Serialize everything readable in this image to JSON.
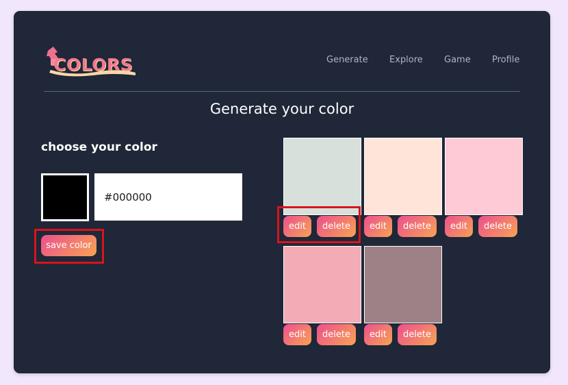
{
  "app": {
    "logo_text": "COLORS",
    "logo_icon": "paint-bucket-icon"
  },
  "nav": [
    "Generate",
    "Explore",
    "Game",
    "Profile"
  ],
  "page_title": "Generate your color",
  "picker": {
    "heading": "choose your color",
    "selected_color": "#000000",
    "hex_value": "#000000",
    "save_label": "save color"
  },
  "saved_colors": [
    {
      "color": "#d7e0db",
      "edit_label": "edit",
      "delete_label": "delete"
    },
    {
      "color": "#ffe5d9",
      "edit_label": "edit",
      "delete_label": "delete"
    },
    {
      "color": "#fecad5",
      "edit_label": "edit",
      "delete_label": "delete"
    },
    {
      "color": "#f3acb5",
      "edit_label": "edit",
      "delete_label": "delete"
    },
    {
      "color": "#9d8186",
      "edit_label": "edit",
      "delete_label": "delete"
    }
  ],
  "colors": {
    "card_background": "#1f2738",
    "page_background": "#f1e6fb",
    "button_gradient_start": "#ec4f8e",
    "button_gradient_end": "#f8a353",
    "highlight": "#d8141c"
  }
}
